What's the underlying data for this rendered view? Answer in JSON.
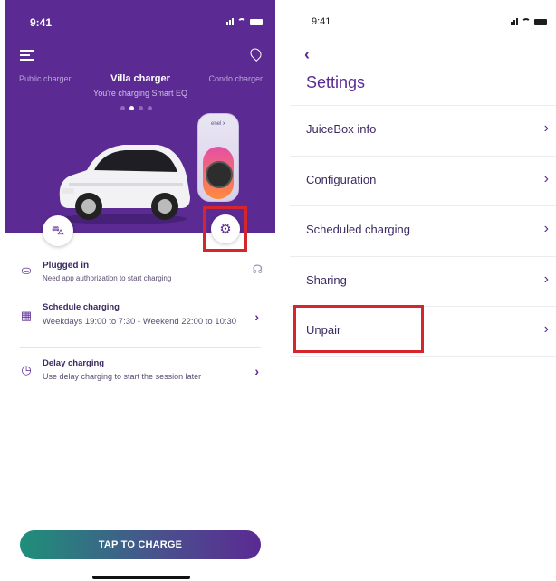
{
  "left": {
    "status_time": "9:41",
    "carousel": {
      "prev_label": "Public charger",
      "current_label": "Villa charger",
      "next_label": "Condo charger",
      "subtitle": "You're charging Smart EQ"
    },
    "charger_brand": "enel x",
    "rows": {
      "plugged": {
        "title": "Plugged in",
        "desc": "Need app authorization to start charging"
      },
      "schedule": {
        "title": "Schedule charging",
        "desc": "Weekdays 19:00 to 7:30 - Weekend 22:00 to 10:30"
      },
      "delay": {
        "title": "Delay charging",
        "desc": "Use delay charging to start the session later"
      }
    },
    "cta_label": "TAP TO CHARGE"
  },
  "right": {
    "status_time": "9:41",
    "back_glyph": "‹",
    "title": "Settings",
    "items": [
      {
        "label": "JuiceBox info"
      },
      {
        "label": "Configuration"
      },
      {
        "label": "Scheduled charging"
      },
      {
        "label": "Sharing"
      },
      {
        "label": "Unpair"
      }
    ]
  },
  "colors": {
    "brand_purple": "#5b2a93",
    "highlight_red": "#d6262d"
  }
}
